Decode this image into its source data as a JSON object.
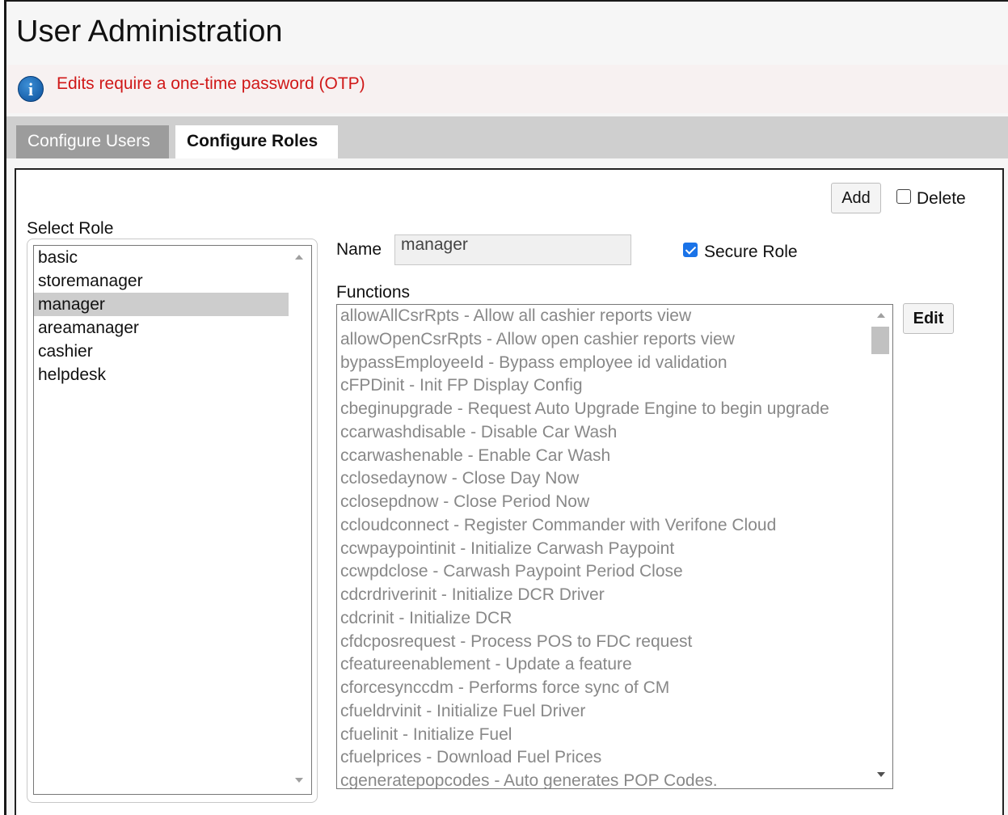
{
  "page": {
    "title": "User Administration"
  },
  "notice": {
    "icon": "info-icon",
    "text": "Edits require a one-time password (OTP)",
    "color": "#d01818"
  },
  "tabs": [
    {
      "label": "Configure Users",
      "active": false
    },
    {
      "label": "Configure Roles",
      "active": true
    }
  ],
  "toolbar": {
    "add_label": "Add",
    "delete_label": "Delete",
    "delete_checked": false
  },
  "roles": {
    "label": "Select Role",
    "items": [
      "basic",
      "storemanager",
      "manager",
      "areamanager",
      "cashier",
      "helpdesk"
    ],
    "selected": "manager"
  },
  "form": {
    "name_label": "Name",
    "name_value": "manager",
    "secure_label": "Secure Role",
    "secure_checked": true,
    "functions_label": "Functions",
    "edit_label": "Edit"
  },
  "functions": [
    "allowAllCsrRpts - Allow all cashier reports view",
    "allowOpenCsrRpts - Allow open cashier reports view",
    "bypassEmployeeId - Bypass employee id validation",
    "cFPDinit - Init FP Display Config",
    "cbeginupgrade - Request Auto Upgrade Engine to begin upgrade",
    "ccarwashdisable - Disable Car Wash",
    "ccarwashenable - Enable Car Wash",
    "cclosedaynow - Close Day Now",
    "cclosepdnow - Close Period Now",
    "ccloudconnect - Register Commander with Verifone Cloud",
    "ccwpaypointinit - Initialize Carwash Paypoint",
    "ccwpdclose - Carwash Paypoint Period Close",
    "cdcrdriverinit - Initialize DCR Driver",
    "cdcrinit - Initialize DCR",
    "cfdcposrequest - Process POS to FDC request",
    "cfeatureenablement - Update a feature",
    "cforcesynccdm - Performs force sync of CM",
    "cfueldrvinit - Initialize Fuel Driver",
    "cfuelinit - Initialize Fuel",
    "cfuelprices - Download Fuel Prices",
    "cgeneratepopcodes - Auto generates POP Codes."
  ]
}
